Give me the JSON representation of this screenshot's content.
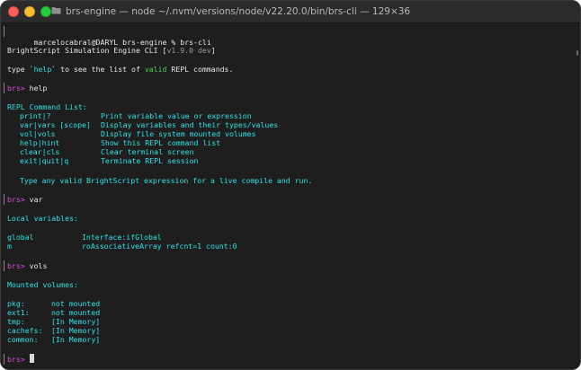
{
  "window": {
    "title": "brs-engine — node ~/.nvm/versions/node/v22.20.0/bin/brs-cli — 129×36"
  },
  "colors": {
    "cyan": "#2fe0e6",
    "prompt": "#d94de0",
    "green": "#4fd24f",
    "text": "#e6e6e6",
    "background": "#1e1e1e"
  },
  "terminal": {
    "shell_prompt": "marcelocabral@DARYL brs-engine % brs-cli",
    "banner_name": "BrightScript Simulation Engine CLI [",
    "banner_version": "v1.9.0 dev",
    "banner_close": "]",
    "hint_pre": "type `",
    "hint_help": "help",
    "hint_mid": "` to see the list of ",
    "hint_valid": "valid",
    "hint_post": " REPL commands.",
    "prompt": "brs>",
    "cmd_help": "help",
    "repl_header": "REPL Command List:",
    "commands": [
      {
        "cmd": "print|?",
        "desc": "Print variable value or expression"
      },
      {
        "cmd": "var|vars [scope]",
        "desc": "Display variables and their types/values"
      },
      {
        "cmd": "vol|vols",
        "desc": "Display file system mounted volumes"
      },
      {
        "cmd": "help|hint",
        "desc": "Show this REPL command list"
      },
      {
        "cmd": "clear|cls",
        "desc": "Clear terminal screen"
      },
      {
        "cmd": "exit|quit|q",
        "desc": "Terminate REPL session"
      }
    ],
    "type_note": "Type any valid BrightScript expression for a live compile and run.",
    "cmd_var": "var",
    "local_header": "Local variables:",
    "variables": [
      {
        "name": "global",
        "value": "Interface:ifGlobal"
      },
      {
        "name": "m",
        "value": "roAssociativeArray refcnt=1 count:0"
      }
    ],
    "cmd_vols": "vols",
    "volumes_header": "Mounted volumes:",
    "volumes": [
      {
        "name": "pkg:",
        "status": "not mounted"
      },
      {
        "name": "ext1:",
        "status": "not mounted"
      },
      {
        "name": "tmp:",
        "status": "[In Memory]"
      },
      {
        "name": "cachefs:",
        "status": "[In Memory]"
      },
      {
        "name": "common:",
        "status": "[In Memory]"
      }
    ]
  }
}
